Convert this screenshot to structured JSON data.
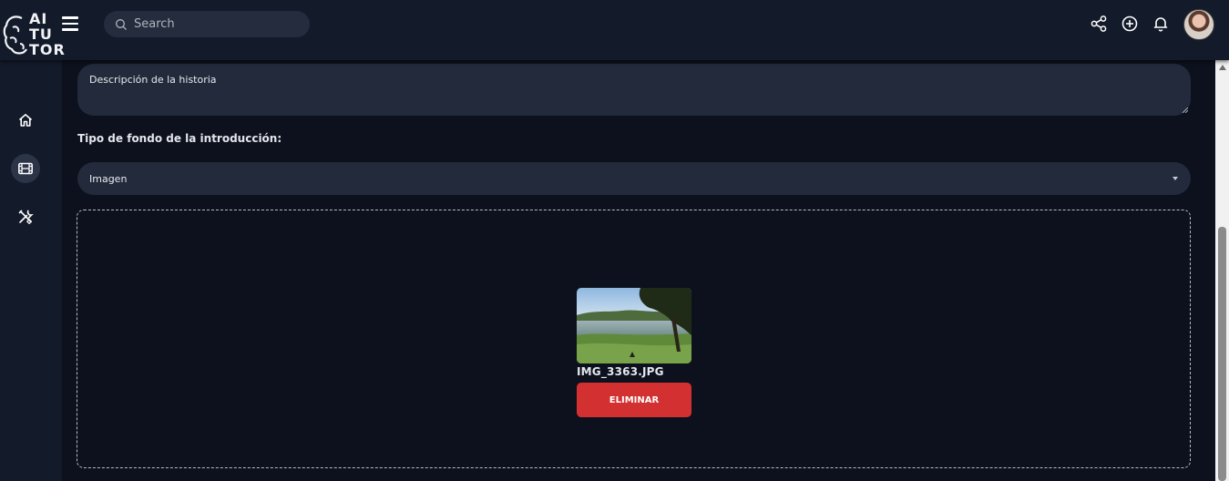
{
  "app": {
    "logo_lines": [
      "AI",
      "TU",
      "TOR"
    ]
  },
  "header": {
    "search_placeholder": "Search",
    "icons": [
      "share-icon",
      "plus-circle-icon",
      "bell-icon",
      "avatar"
    ]
  },
  "sidebar": {
    "items": [
      {
        "icon": "home-icon",
        "active": false
      },
      {
        "icon": "film-icon",
        "active": true
      },
      {
        "icon": "tools-icon",
        "active": false
      }
    ]
  },
  "form": {
    "description_placeholder": "Descripción de la historia",
    "background_type_label": "Tipo de fondo de la introducción:",
    "background_type_value": "Imagen",
    "file_name": "IMG_3363.JPG",
    "delete_label": "ELIMINAR"
  },
  "colors": {
    "background": "#0c111d",
    "panel": "#131a2a",
    "field": "#222a3b",
    "delete": "#d33131"
  }
}
